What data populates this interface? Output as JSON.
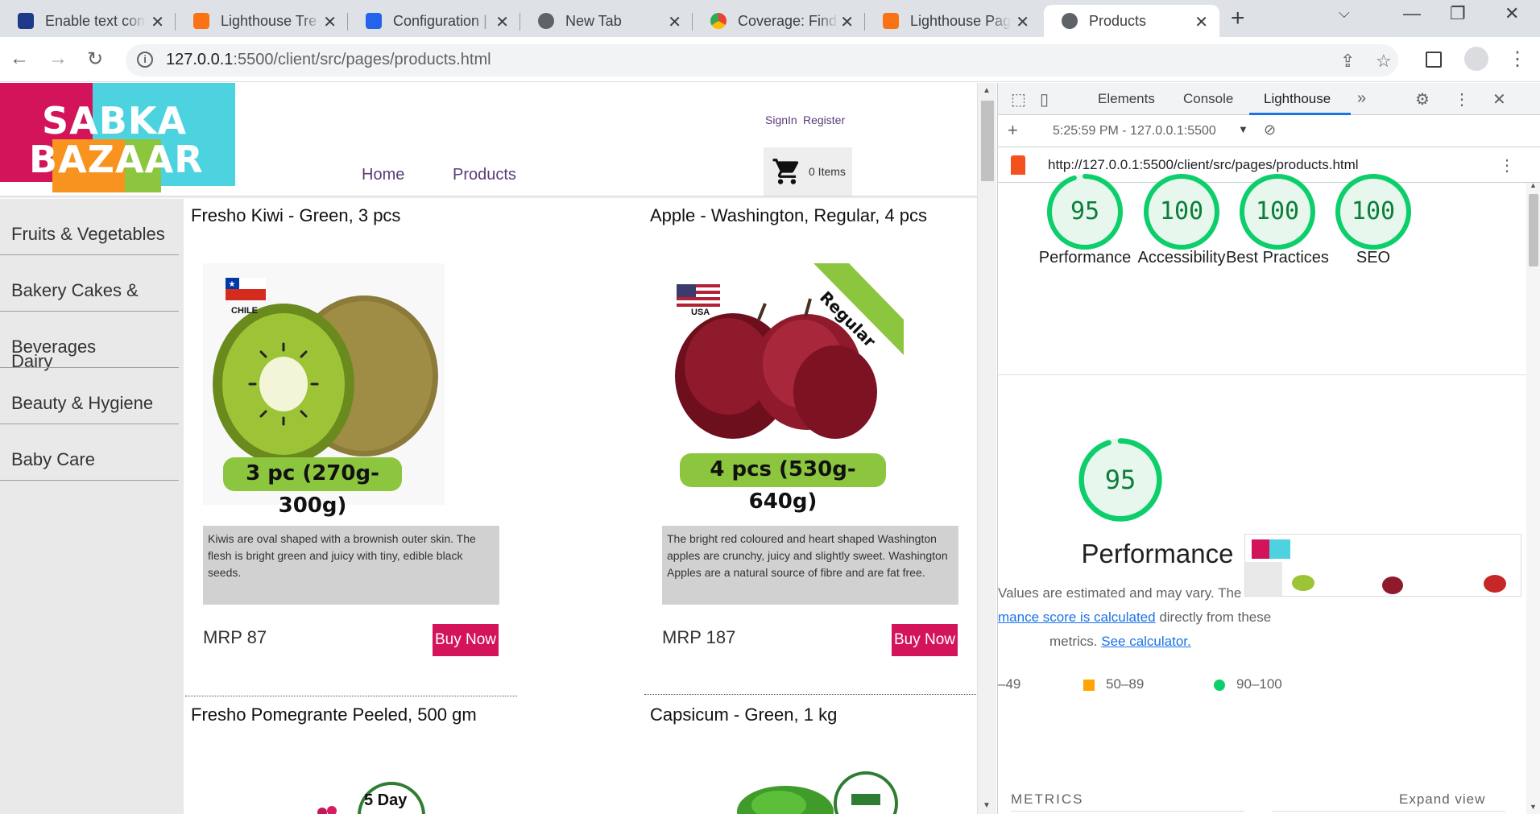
{
  "browser": {
    "tabs": [
      {
        "title": "Enable text com",
        "color": "#1e3a8a"
      },
      {
        "title": "Lighthouse Tre",
        "color": "#f97316"
      },
      {
        "title": "Configuration |",
        "color": "#2563eb"
      },
      {
        "title": "New Tab",
        "color": "#5f6368"
      },
      {
        "title": "Coverage: Find",
        "color": "#34a853"
      },
      {
        "title": "Lighthouse Pag",
        "color": "#f97316"
      },
      {
        "title": "Products",
        "color": "#5f6368"
      }
    ],
    "url_host": "127.0.0.1",
    "url_rest": ":5500/client/src/pages/products.html"
  },
  "site": {
    "logo_line1": "SABKA",
    "logo_line2": "BAZAAR",
    "signin": "SignIn",
    "register": "Register",
    "nav_home": "Home",
    "nav_products": "Products",
    "cart_label": "0 Items",
    "categories": [
      "Fruits & Vegetables",
      "Bakery Cakes & Dairy",
      "Beverages",
      "Beauty & Hygiene",
      "Baby Care"
    ],
    "products": [
      {
        "title": "Fresho Kiwi - Green, 3 pcs",
        "country": "CHILE",
        "pack": "3 pc (270g-300g)",
        "description": "Kiwis are oval shaped with a brownish outer skin. The flesh is bright green and juicy with tiny, edible black seeds.",
        "price": "MRP 87",
        "button": "Buy Now"
      },
      {
        "title": "Apple - Washington, Regular, 4 pcs",
        "country": "USA",
        "ribbon": "Regular",
        "pack": "4 pcs (530g-640g)",
        "description": "The bright red coloured and heart shaped Washington apples are crunchy, juicy and slightly sweet. Washington Apples are a natural source of fibre and are fat free.",
        "price": "MRP 187",
        "button": "Buy Now"
      },
      {
        "title": "Fresho Pomegrante Peeled, 500 gm",
        "badge": "5 Day"
      },
      {
        "title": "Capsicum - Green, 1 kg"
      }
    ]
  },
  "devtools": {
    "tabs": [
      "Elements",
      "Console",
      "Lighthouse"
    ],
    "report_time": "5:25:59 PM - 127.0.0.1:5500",
    "report_url": "http://127.0.0.1:5500/client/src/pages/products.html",
    "scores": [
      {
        "value": 95,
        "label": "Performance"
      },
      {
        "value": 100,
        "label": "Accessibility"
      },
      {
        "value": 100,
        "label": "Best Practices"
      },
      {
        "value": 100,
        "label": "SEO"
      }
    ],
    "perf_score": 95,
    "perf_title": "Performance",
    "perf_text1": "Values are estimated and may vary. The",
    "perf_link1": "mance score is calculated",
    "perf_text2": "directly from these",
    "perf_text3": "metrics.",
    "perf_link2": "See calculator.",
    "legend": [
      "–49",
      "50–89",
      "90–100"
    ],
    "metrics_label": "METRICS",
    "expand_label": "Expand view",
    "colors": {
      "pass": "#0cce6b",
      "average": "#ffa400",
      "fail": "#ff4e42"
    }
  }
}
